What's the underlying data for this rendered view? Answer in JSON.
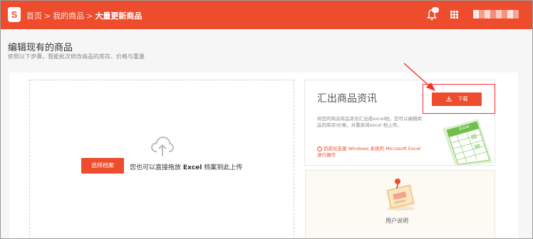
{
  "header": {
    "logo_letter": "S",
    "breadcrumb": {
      "home": "首页",
      "sep": ">",
      "my_products": "我的商品",
      "current": "大量更新商品"
    },
    "notification_count": "..."
  },
  "page": {
    "title": "编辑现有的商品",
    "subtitle": "依照以下步骤，我能批次修改商品的库存、价格与重量"
  },
  "upload": {
    "choose_button": "选择档案",
    "hint_prefix": "您也可以直接拖放",
    "hint_bold": "Excel",
    "hint_suffix": "档案到此上传"
  },
  "export": {
    "title": "汇出商品资讯",
    "download_button": "下载",
    "description": "将您的商店商品资讯汇出成excel档，您可以编辑商品的库存/价格，并重新将excel 档上传。",
    "note": "目前仅支援 Windows 系统的 Microsoft Excel 进行操作",
    "excel_art_label": "Excel"
  },
  "guide": {
    "label": "用户说明"
  },
  "colors": {
    "brand": "#ee4d2d",
    "annotation": "#ff2a2a"
  },
  "icons": {
    "logo": "shopping-bag-icon",
    "bell": "bell-icon",
    "apps": "grid-apps-icon",
    "cloud": "cloud-upload-icon",
    "download": "download-icon",
    "info": "info-icon"
  }
}
